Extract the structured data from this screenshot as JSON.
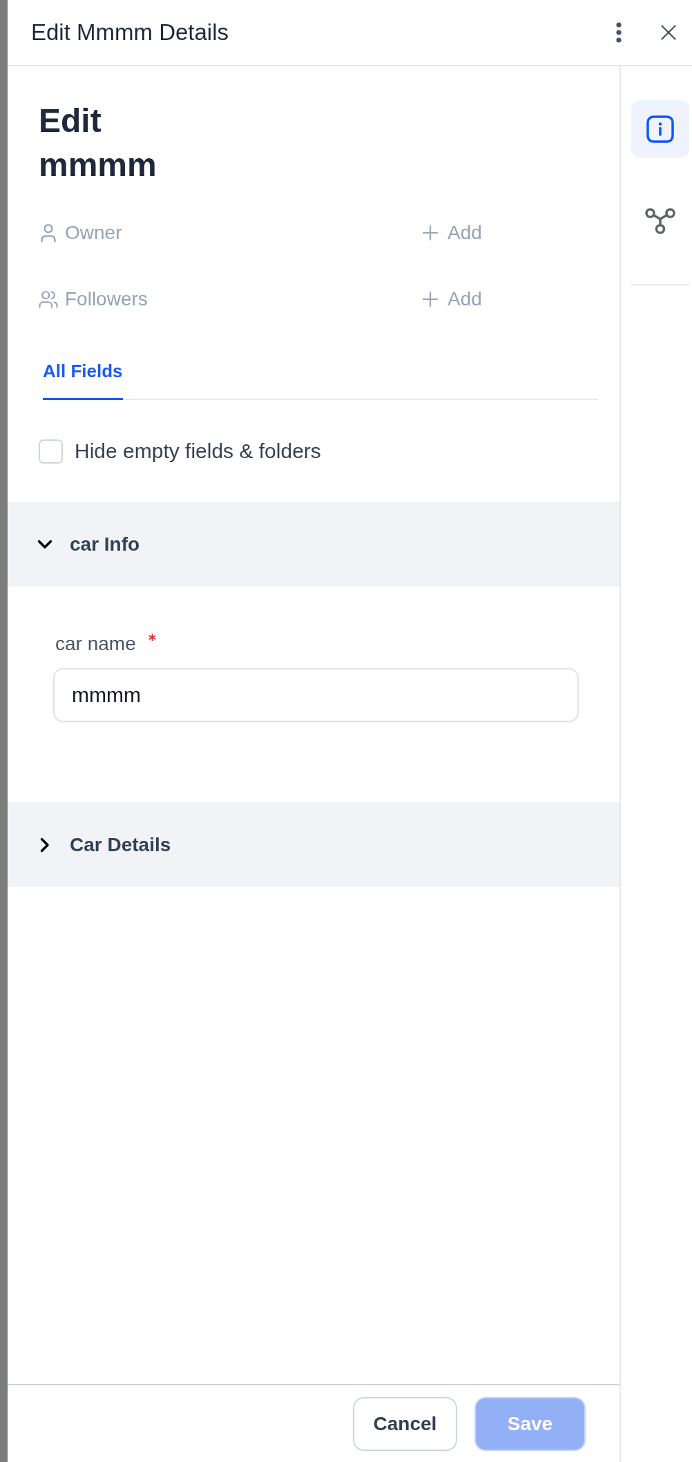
{
  "window": {
    "title": "Edit Mmmm Details"
  },
  "record": {
    "heading": "Edit mmmm"
  },
  "people": [
    {
      "kind": "owner",
      "label": "Owner",
      "action": "Add"
    },
    {
      "kind": "followers",
      "label": "Followers",
      "action": "Add"
    }
  ],
  "tabs": [
    {
      "label": "All Fields",
      "selected": true
    }
  ],
  "hide_empty": {
    "label": "Hide empty fields & folders",
    "checked": false
  },
  "sections": [
    {
      "title": "car Info",
      "expanded": true,
      "fields": [
        {
          "label": "car name",
          "required": true,
          "value": "mmmm"
        }
      ]
    },
    {
      "title": "Car Details",
      "expanded": false
    }
  ],
  "footer": {
    "buttons": [
      {
        "label": "Cancel",
        "kind": "secondary",
        "disabled": false
      },
      {
        "label": "Save",
        "kind": "primary",
        "disabled": true
      }
    ]
  },
  "side_rail": {
    "items": [
      {
        "kind": "info",
        "selected": true
      },
      {
        "kind": "relations",
        "selected": false
      }
    ]
  }
}
